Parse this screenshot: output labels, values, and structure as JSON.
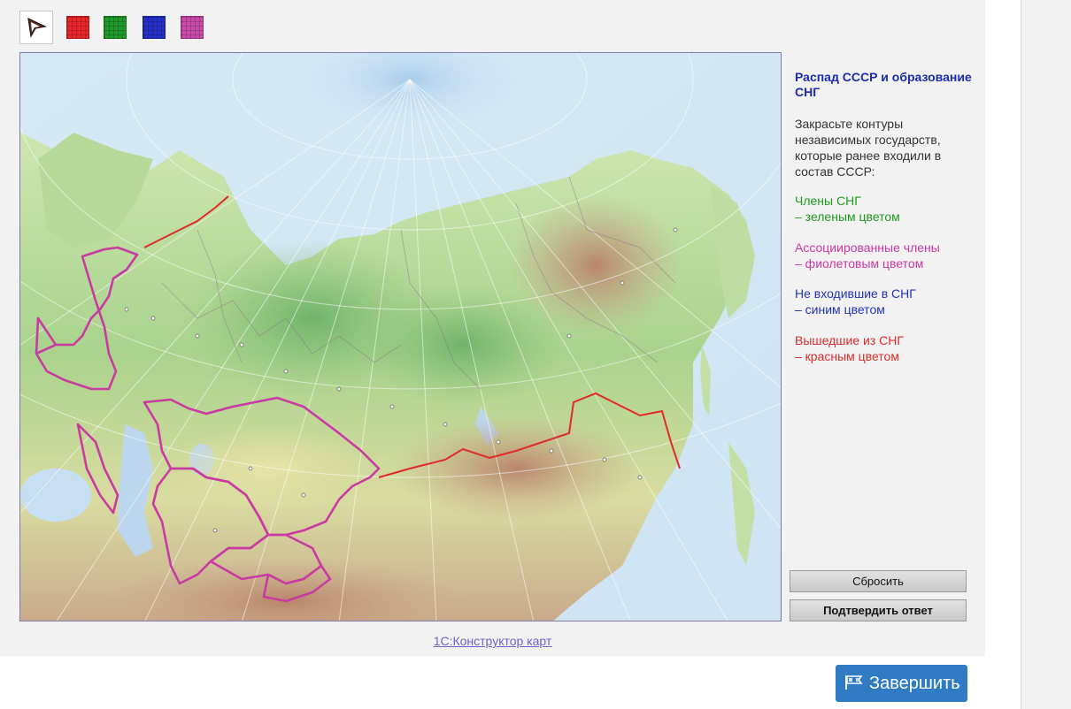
{
  "toolbar": {
    "tools": [
      {
        "name": "pointer",
        "icon": "cursor-arrow-icon"
      },
      {
        "name": "red",
        "color": "#e8262a"
      },
      {
        "name": "green",
        "color": "#1f9a2a"
      },
      {
        "name": "blue",
        "color": "#2330c8"
      },
      {
        "name": "magenta",
        "color": "#c84aa8"
      }
    ]
  },
  "sidebar": {
    "title": "Распад СССР и образование СНГ",
    "intro": "Закрасьте контуры независимых государств, которые ранее входили в состав СССР:",
    "legend": {
      "green_1": "Члены СНГ",
      "green_2": "– зеленым цветом",
      "magenta_1": "Ассоциированные члены",
      "magenta_2": "– фиолетовым цветом",
      "blue_1": "Не входившие в СНГ",
      "blue_2": "– синим цветом",
      "red_1": "Вышедшие из СНГ",
      "red_2": "– красным цветом"
    },
    "reset_label": "Сбросить",
    "confirm_label": "Подтвердить ответ"
  },
  "footer": {
    "link_text": "1С:Конструктор карт",
    "finish_label": "Завершить"
  },
  "colors": {
    "accent": "#2f7cc4",
    "outline": "#c93aa2",
    "border_red": "#e02a2a"
  }
}
